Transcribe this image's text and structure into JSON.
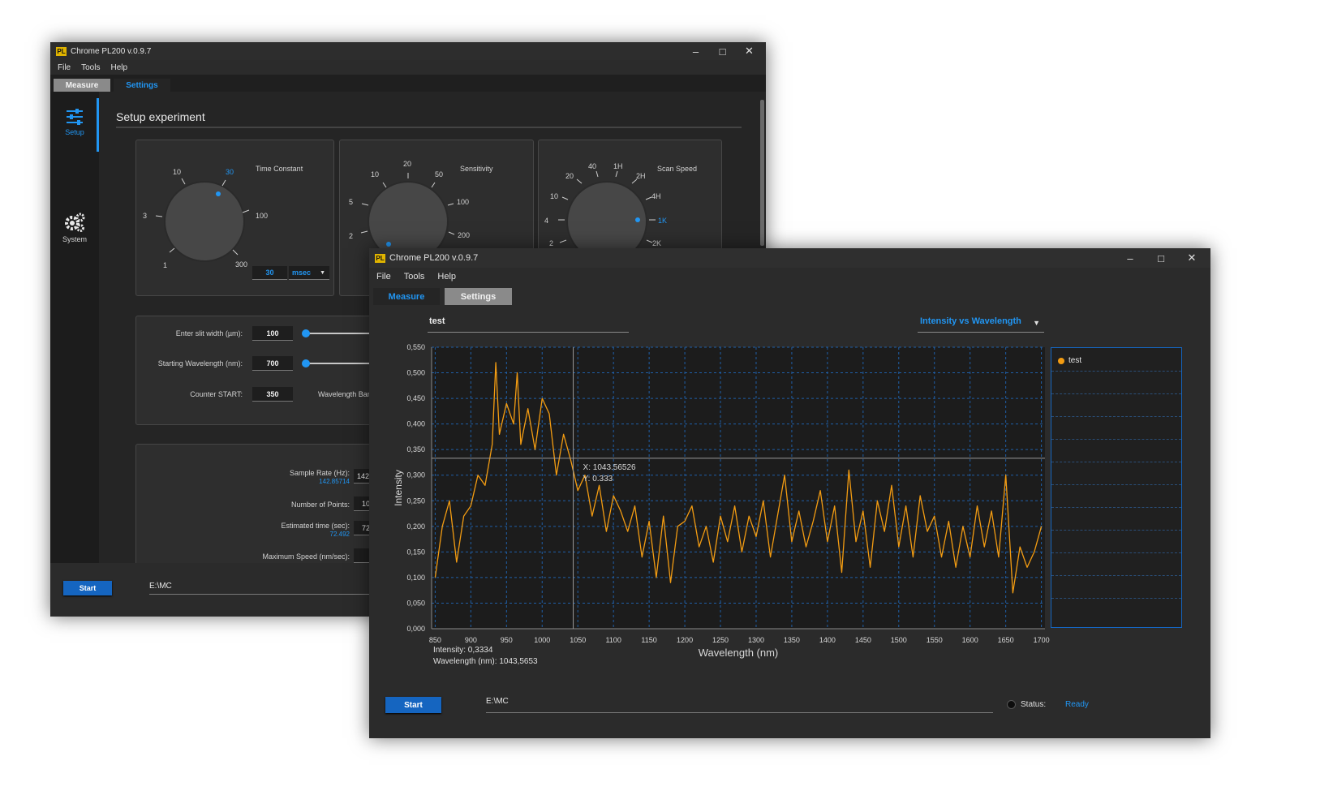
{
  "back_window": {
    "title": "Chrome PL200 v.0.9.7",
    "logo_text": "PL",
    "menu": [
      "File",
      "Tools",
      "Help"
    ],
    "tabs": [
      "Measure",
      "Settings"
    ],
    "sidebar": [
      {
        "label": "Setup",
        "icon": "sliders-icon"
      },
      {
        "label": "System",
        "icon": "gears-icon"
      }
    ],
    "section_title": "Setup experiment",
    "dials": [
      {
        "name": "Time Constant",
        "ticks": [
          "3",
          "10",
          "30",
          "100",
          "300",
          "1"
        ],
        "selected": "30",
        "value": "30",
        "unit": "msec"
      },
      {
        "name": "Sensitivity",
        "ticks": [
          "2",
          "5",
          "10",
          "20",
          "50",
          "100",
          "200"
        ],
        "selected": "2"
      },
      {
        "name": "Scan Speed",
        "ticks": [
          "2",
          "4",
          "10",
          "20",
          "40",
          "1H",
          "2H",
          "4H",
          "1K",
          "2K"
        ],
        "selected": "1K"
      }
    ],
    "slit": {
      "label": "Enter slit width (µm):",
      "value": "100"
    },
    "start_wl": {
      "label": "Starting Wavelength (nm):",
      "value": "700"
    },
    "counter": {
      "label": "Counter START:",
      "value": "350",
      "side_label": "Wavelength Band"
    },
    "sample_rate": {
      "label": "Sample Rate (Hz):",
      "sub": "142.85714",
      "value": "142"
    },
    "num_points": {
      "label": "Number of Points:",
      "value": "10"
    },
    "est_time": {
      "label": "Estimated time (sec):",
      "sub": "72.492",
      "value": "72"
    },
    "max_speed": {
      "label": "Maximum Speed (nm/sec):"
    },
    "start_button": "Start",
    "path": "E:\\MC"
  },
  "front_window": {
    "title": "Chrome PL200 v.0.9.7",
    "logo_text": "PL",
    "menu": [
      "File",
      "Tools",
      "Help"
    ],
    "tabs": [
      "Measure",
      "Settings"
    ],
    "chart_name": "test",
    "view_select": "Intensity vs Wavelength",
    "crosshair": {
      "x_text": "X: 1043.56526",
      "y_text": "Y: 0.333"
    },
    "readout_intensity": "Intensity: 0,3334",
    "readout_wavelength": "Wavelength (nm): 1043,5653",
    "start_button": "Start",
    "path": "E:\\MC",
    "status_label": "Status:",
    "status_value": "Ready"
  },
  "chart_data": {
    "type": "line",
    "xlabel": "Wavelength (nm)",
    "ylabel": "Intensity",
    "xlim": [
      845,
      1705
    ],
    "ylim": [
      0,
      0.55
    ],
    "xticks": [
      850,
      900,
      950,
      1000,
      1050,
      1100,
      1150,
      1200,
      1250,
      1300,
      1350,
      1400,
      1450,
      1500,
      1550,
      1600,
      1650,
      1700
    ],
    "yticks": [
      "0,000",
      "0,050",
      "0,100",
      "0,150",
      "0,200",
      "0,250",
      "0,300",
      "0,350",
      "0,400",
      "0,450",
      "0,500",
      "0,550"
    ],
    "grid": true,
    "legend_placement": "right",
    "crosshair": {
      "x": 1043.56526,
      "y": 0.333
    },
    "series": [
      {
        "name": "test",
        "color": "#f39c12",
        "x": [
          850,
          860,
          870,
          880,
          890,
          900,
          910,
          920,
          930,
          935,
          940,
          950,
          960,
          965,
          970,
          980,
          990,
          1000,
          1010,
          1020,
          1030,
          1040,
          1050,
          1060,
          1070,
          1080,
          1090,
          1100,
          1110,
          1120,
          1130,
          1140,
          1150,
          1160,
          1170,
          1180,
          1190,
          1200,
          1210,
          1220,
          1230,
          1240,
          1250,
          1260,
          1270,
          1280,
          1290,
          1300,
          1310,
          1320,
          1330,
          1340,
          1350,
          1360,
          1370,
          1380,
          1390,
          1400,
          1410,
          1420,
          1430,
          1440,
          1450,
          1460,
          1470,
          1480,
          1490,
          1500,
          1510,
          1520,
          1530,
          1540,
          1550,
          1560,
          1570,
          1580,
          1590,
          1600,
          1610,
          1620,
          1630,
          1640,
          1650,
          1660,
          1670,
          1680,
          1690,
          1700
        ],
        "y": [
          0.1,
          0.2,
          0.25,
          0.13,
          0.22,
          0.24,
          0.3,
          0.28,
          0.36,
          0.52,
          0.38,
          0.44,
          0.4,
          0.5,
          0.36,
          0.43,
          0.35,
          0.45,
          0.42,
          0.3,
          0.38,
          0.33,
          0.27,
          0.3,
          0.22,
          0.28,
          0.19,
          0.26,
          0.23,
          0.19,
          0.24,
          0.14,
          0.21,
          0.1,
          0.22,
          0.09,
          0.2,
          0.21,
          0.24,
          0.16,
          0.2,
          0.13,
          0.22,
          0.17,
          0.24,
          0.15,
          0.22,
          0.18,
          0.25,
          0.14,
          0.22,
          0.3,
          0.17,
          0.23,
          0.16,
          0.21,
          0.27,
          0.17,
          0.24,
          0.11,
          0.31,
          0.17,
          0.23,
          0.12,
          0.25,
          0.19,
          0.28,
          0.16,
          0.24,
          0.14,
          0.26,
          0.19,
          0.22,
          0.14,
          0.21,
          0.12,
          0.2,
          0.14,
          0.24,
          0.16,
          0.23,
          0.14,
          0.3,
          0.07,
          0.16,
          0.12,
          0.15,
          0.2
        ]
      }
    ]
  },
  "colors": {
    "accent": "#2196f3",
    "series": "#f39c12",
    "button": "#1565c0"
  }
}
